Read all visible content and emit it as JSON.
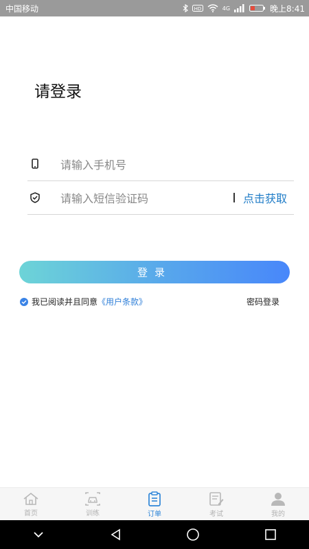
{
  "status_bar": {
    "carrier": "中国移动",
    "time": "晚上8:41",
    "network": "4G"
  },
  "page": {
    "title": "请登录"
  },
  "form": {
    "phone_placeholder": "请输入手机号",
    "code_placeholder": "请输入短信验证码",
    "get_code_label": "点击获取",
    "login_label": "登录",
    "agreement_text": "我已阅读并且同意",
    "terms_link": "《用户条款》",
    "password_login_label": "密码登录"
  },
  "tabs": [
    {
      "label": "首页",
      "icon": "home-icon"
    },
    {
      "label": "训练",
      "icon": "car-icon"
    },
    {
      "label": "订单",
      "icon": "clipboard-icon",
      "active": true
    },
    {
      "label": "考试",
      "icon": "exam-icon"
    },
    {
      "label": "我的",
      "icon": "user-icon"
    }
  ],
  "colors": {
    "accent": "#2f86d8",
    "button_gradient_start": "#6dd4d7",
    "button_gradient_end": "#4887fa",
    "status_bar": "#9a9a9a"
  }
}
